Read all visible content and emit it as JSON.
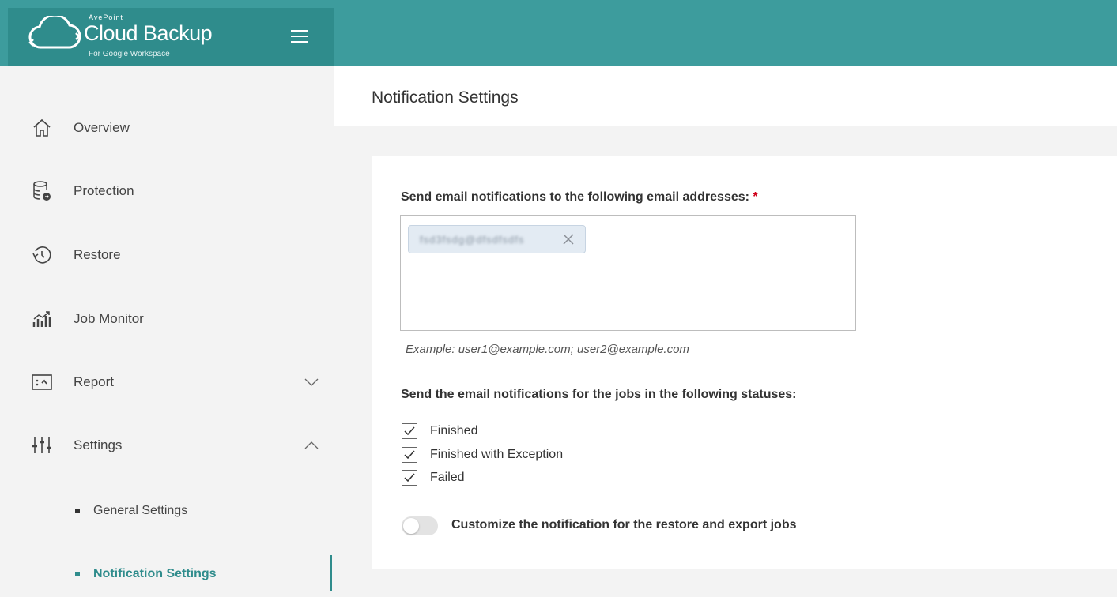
{
  "brand": {
    "vendor": "AvePoint",
    "product": "Cloud Backup",
    "subtitle": "For Google Workspace"
  },
  "colors": {
    "topbar": "#3d9c9d",
    "logo_area": "#2f8c8c",
    "accent": "#2f8c8c",
    "required": "#d0021b"
  },
  "sidebar": {
    "items": [
      {
        "label": "Overview",
        "icon": "home-icon"
      },
      {
        "label": "Protection",
        "icon": "database-icon"
      },
      {
        "label": "Restore",
        "icon": "history-icon"
      },
      {
        "label": "Job Monitor",
        "icon": "bar-chart-icon"
      },
      {
        "label": "Report",
        "icon": "report-icon",
        "expanded": false
      },
      {
        "label": "Settings",
        "icon": "sliders-icon",
        "expanded": true
      }
    ],
    "sub_items": [
      {
        "label": "General Settings",
        "active": false
      },
      {
        "label": "Notification Settings",
        "active": true
      }
    ]
  },
  "page": {
    "title": "Notification Settings"
  },
  "form": {
    "email_label": "Send email notifications to the following email addresses:",
    "required_mark": "*",
    "email_chip": "fsd3fsdg@dfsdfsdfs",
    "example": "Example: user1@example.com; user2@example.com",
    "status_label": "Send the email notifications for the jobs in the following statuses:",
    "statuses": [
      {
        "label": "Finished",
        "checked": true
      },
      {
        "label": "Finished with Exception",
        "checked": true
      },
      {
        "label": "Failed",
        "checked": true
      }
    ],
    "customize_label": "Customize the notification for the restore and export jobs",
    "customize_enabled": false
  }
}
